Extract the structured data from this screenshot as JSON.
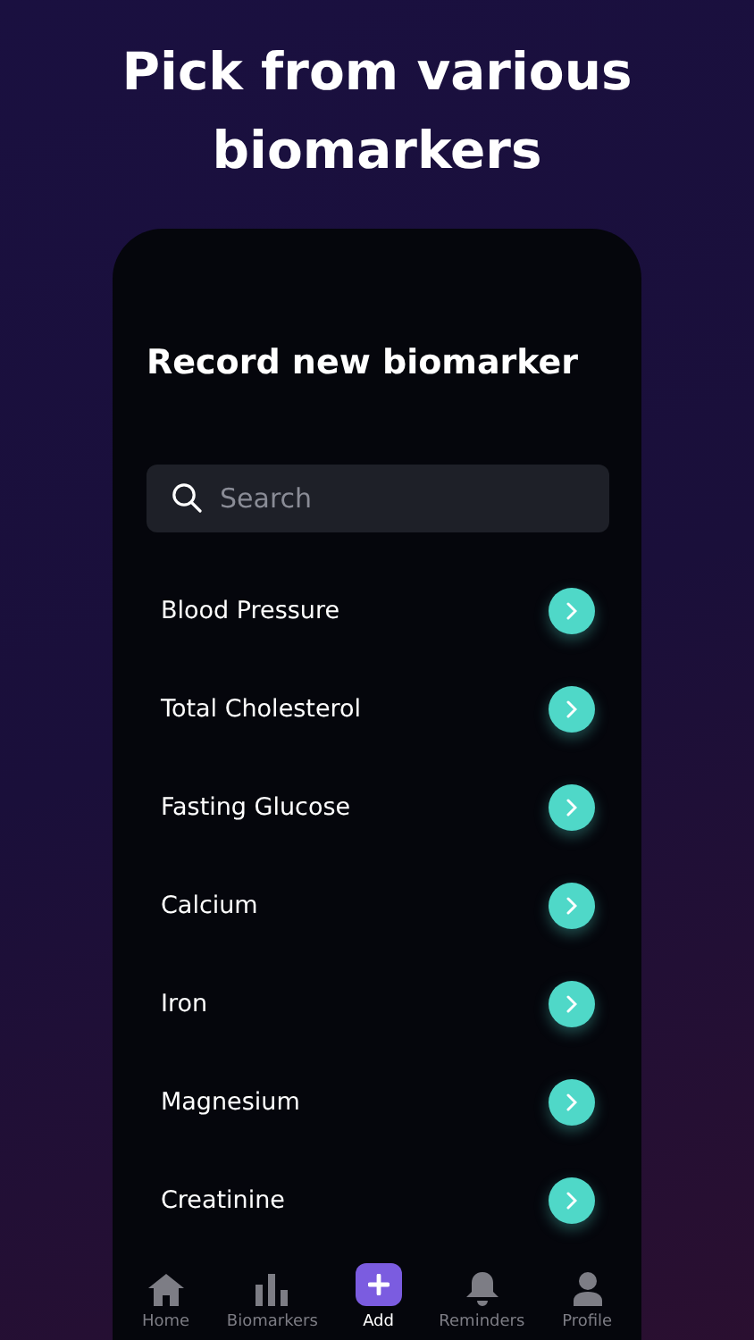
{
  "headline": "Pick from various biomarkers",
  "screen": {
    "title": "Record new biomarker",
    "search": {
      "placeholder": "Search"
    },
    "biomarkers": [
      {
        "name": "Blood Pressure"
      },
      {
        "name": "Total Cholesterol"
      },
      {
        "name": "Fasting Glucose"
      },
      {
        "name": "Calcium"
      },
      {
        "name": "Iron"
      },
      {
        "name": "Magnesium"
      },
      {
        "name": "Creatinine"
      }
    ],
    "tab_bar": [
      {
        "kind": "home",
        "label": "Home",
        "selected": false
      },
      {
        "kind": "chart",
        "label": "Biomarkers",
        "selected": false
      },
      {
        "kind": "add",
        "label": "Add",
        "selected": true
      },
      {
        "kind": "bell",
        "label": "Reminders",
        "selected": false
      },
      {
        "kind": "person",
        "label": "Profile",
        "selected": false
      }
    ]
  }
}
